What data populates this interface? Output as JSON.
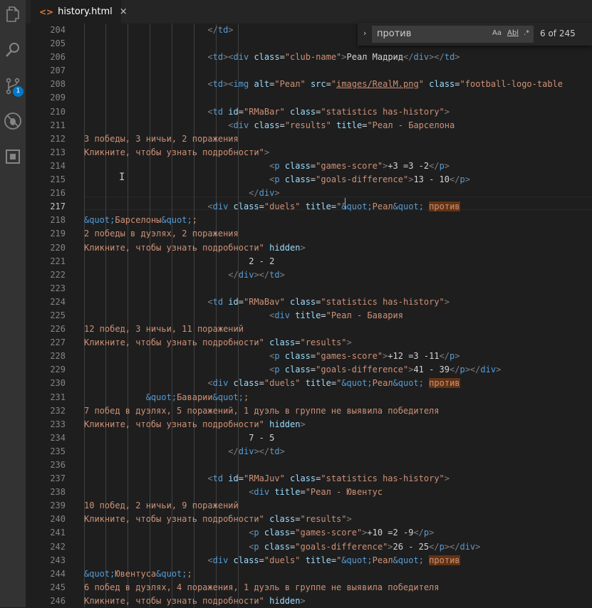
{
  "tab": {
    "icon": "<>",
    "filename": "history.html",
    "close": "×"
  },
  "activity": {
    "scm_badge": "1"
  },
  "find": {
    "query": "против",
    "case_label": "Aa",
    "word_label": "Abl",
    "regex_label": ".*",
    "count": "6 of 245"
  },
  "current_line": "217",
  "lines": [
    {
      "n": "204",
      "t": [
        [
          "tx",
          "                        "
        ],
        [
          "tg",
          "</"
        ],
        [
          "tn",
          "td"
        ],
        [
          "tg",
          ">"
        ]
      ]
    },
    {
      "n": "205",
      "t": []
    },
    {
      "n": "206",
      "t": [
        [
          "tx",
          "                        "
        ],
        [
          "tg",
          "<"
        ],
        [
          "tn",
          "td"
        ],
        [
          "tg",
          "><"
        ],
        [
          "tn",
          "div"
        ],
        [
          "an",
          " class"
        ],
        [
          "tx",
          "="
        ],
        [
          "av",
          "\"club-name\""
        ],
        [
          "tg",
          ">"
        ],
        [
          "tx",
          "Реал Мадрид"
        ],
        [
          "tg",
          "</"
        ],
        [
          "tn",
          "div"
        ],
        [
          "tg",
          "></"
        ],
        [
          "tn",
          "td"
        ],
        [
          "tg",
          ">"
        ]
      ]
    },
    {
      "n": "207",
      "t": []
    },
    {
      "n": "208",
      "t": [
        [
          "tx",
          "                        "
        ],
        [
          "tg",
          "<"
        ],
        [
          "tn",
          "td"
        ],
        [
          "tg",
          "><"
        ],
        [
          "tn",
          "img"
        ],
        [
          "an",
          " alt"
        ],
        [
          "tx",
          "="
        ],
        [
          "av",
          "\"Реал\""
        ],
        [
          "an",
          " src"
        ],
        [
          "tx",
          "="
        ],
        [
          "av",
          "\""
        ],
        [
          "avu",
          "images/RealM.png"
        ],
        [
          "av",
          "\""
        ],
        [
          "an",
          " class"
        ],
        [
          "tx",
          "="
        ],
        [
          "av",
          "\"football-logo-table"
        ]
      ]
    },
    {
      "n": "209",
      "t": []
    },
    {
      "n": "210",
      "t": [
        [
          "tx",
          "                        "
        ],
        [
          "tg",
          "<"
        ],
        [
          "tn",
          "td"
        ],
        [
          "an",
          " id"
        ],
        [
          "tx",
          "="
        ],
        [
          "av",
          "\"RMaBar\""
        ],
        [
          "an",
          " class"
        ],
        [
          "tx",
          "="
        ],
        [
          "av",
          "\"statistics has-history\""
        ],
        [
          "tg",
          ">"
        ]
      ]
    },
    {
      "n": "211",
      "t": [
        [
          "tx",
          "                            "
        ],
        [
          "tg",
          "<"
        ],
        [
          "tn",
          "div"
        ],
        [
          "an",
          " class"
        ],
        [
          "tx",
          "="
        ],
        [
          "av",
          "\"results\""
        ],
        [
          "an",
          " title"
        ],
        [
          "tx",
          "="
        ],
        [
          "av",
          "\"Реал - Барселона"
        ]
      ]
    },
    {
      "n": "212",
      "t": [
        [
          "av",
          "3 победы, 3 ничьи, 2 поражения"
        ]
      ]
    },
    {
      "n": "213",
      "t": [
        [
          "av",
          "Кликните, чтобы узнать подробности\""
        ],
        [
          "tg",
          ">"
        ]
      ]
    },
    {
      "n": "214",
      "t": [
        [
          "tx",
          "                                    "
        ],
        [
          "tg",
          "<"
        ],
        [
          "tn",
          "p"
        ],
        [
          "an",
          " class"
        ],
        [
          "tx",
          "="
        ],
        [
          "av",
          "\"games-score\""
        ],
        [
          "tg",
          ">"
        ],
        [
          "tx",
          "+3 =3 -2"
        ],
        [
          "tg",
          "</"
        ],
        [
          "tn",
          "p"
        ],
        [
          "tg",
          ">"
        ]
      ]
    },
    {
      "n": "215",
      "t": [
        [
          "tx",
          "                                    "
        ],
        [
          "tg",
          "<"
        ],
        [
          "tn",
          "p"
        ],
        [
          "an",
          " class"
        ],
        [
          "tx",
          "="
        ],
        [
          "av",
          "\"goals-difference\""
        ],
        [
          "tg",
          ">"
        ],
        [
          "tx",
          "13 - 10"
        ],
        [
          "tg",
          "</"
        ],
        [
          "tn",
          "p"
        ],
        [
          "tg",
          ">"
        ]
      ]
    },
    {
      "n": "216",
      "t": [
        [
          "tx",
          "                                "
        ],
        [
          "tg",
          "</"
        ],
        [
          "tn",
          "div"
        ],
        [
          "tg",
          ">"
        ]
      ]
    },
    {
      "n": "217",
      "t": [
        [
          "tx",
          "                        "
        ],
        [
          "tg",
          "<"
        ],
        [
          "tn",
          "div"
        ],
        [
          "an",
          " class"
        ],
        [
          "tx",
          "="
        ],
        [
          "av",
          "\"duels\""
        ],
        [
          "an",
          " title"
        ],
        [
          "tx",
          "="
        ],
        [
          "av",
          "\""
        ],
        [
          "en",
          "&quot;"
        ],
        [
          "av",
          "Реал"
        ],
        [
          "en",
          "&quot;"
        ],
        [
          "av",
          " "
        ],
        [
          "hl",
          "против"
        ]
      ]
    },
    {
      "n": "218",
      "t": [
        [
          "en",
          "&quot;"
        ],
        [
          "av",
          "Барселоны"
        ],
        [
          "en",
          "&quot;"
        ],
        [
          "av",
          ";"
        ]
      ]
    },
    {
      "n": "219",
      "t": [
        [
          "av",
          "2 победы в дуэлях, 2 поражения"
        ]
      ]
    },
    {
      "n": "220",
      "t": [
        [
          "av",
          "Кликните, чтобы узнать подробности\""
        ],
        [
          "an",
          " hidden"
        ],
        [
          "tg",
          ">"
        ]
      ]
    },
    {
      "n": "221",
      "t": [
        [
          "tx",
          "                                2 - 2"
        ]
      ]
    },
    {
      "n": "222",
      "t": [
        [
          "tx",
          "                            "
        ],
        [
          "tg",
          "</"
        ],
        [
          "tn",
          "div"
        ],
        [
          "tg",
          "></"
        ],
        [
          "tn",
          "td"
        ],
        [
          "tg",
          ">"
        ]
      ]
    },
    {
      "n": "223",
      "t": []
    },
    {
      "n": "224",
      "t": [
        [
          "tx",
          "                        "
        ],
        [
          "tg",
          "<"
        ],
        [
          "tn",
          "td"
        ],
        [
          "an",
          " id"
        ],
        [
          "tx",
          "="
        ],
        [
          "av",
          "\"RMaBav\""
        ],
        [
          "an",
          " class"
        ],
        [
          "tx",
          "="
        ],
        [
          "av",
          "\"statistics has-history\""
        ],
        [
          "tg",
          ">"
        ]
      ]
    },
    {
      "n": "225",
      "t": [
        [
          "tx",
          "                                    "
        ],
        [
          "tg",
          "<"
        ],
        [
          "tn",
          "div"
        ],
        [
          "an",
          " title"
        ],
        [
          "tx",
          "="
        ],
        [
          "av",
          "\"Реал - Бавария"
        ]
      ]
    },
    {
      "n": "226",
      "t": [
        [
          "av",
          "12 побед, 3 ничьи, 11 поражений"
        ]
      ]
    },
    {
      "n": "227",
      "t": [
        [
          "av",
          "Кликните, чтобы узнать подробности\""
        ],
        [
          "an",
          " class"
        ],
        [
          "tx",
          "="
        ],
        [
          "av",
          "\"results\""
        ],
        [
          "tg",
          ">"
        ]
      ]
    },
    {
      "n": "228",
      "t": [
        [
          "tx",
          "                                    "
        ],
        [
          "tg",
          "<"
        ],
        [
          "tn",
          "p"
        ],
        [
          "an",
          " class"
        ],
        [
          "tx",
          "="
        ],
        [
          "av",
          "\"games-score\""
        ],
        [
          "tg",
          ">"
        ],
        [
          "tx",
          "+12 =3 -11"
        ],
        [
          "tg",
          "</"
        ],
        [
          "tn",
          "p"
        ],
        [
          "tg",
          ">"
        ]
      ]
    },
    {
      "n": "229",
      "t": [
        [
          "tx",
          "                                    "
        ],
        [
          "tg",
          "<"
        ],
        [
          "tn",
          "p"
        ],
        [
          "an",
          " class"
        ],
        [
          "tx",
          "="
        ],
        [
          "av",
          "\"goals-difference\""
        ],
        [
          "tg",
          ">"
        ],
        [
          "tx",
          "41 - 39"
        ],
        [
          "tg",
          "</"
        ],
        [
          "tn",
          "p"
        ],
        [
          "tg",
          "></"
        ],
        [
          "tn",
          "div"
        ],
        [
          "tg",
          ">"
        ]
      ]
    },
    {
      "n": "230",
      "t": [
        [
          "tx",
          "                        "
        ],
        [
          "tg",
          "<"
        ],
        [
          "tn",
          "div"
        ],
        [
          "an",
          " class"
        ],
        [
          "tx",
          "="
        ],
        [
          "av",
          "\"duels\""
        ],
        [
          "an",
          " title"
        ],
        [
          "tx",
          "="
        ],
        [
          "av",
          "\""
        ],
        [
          "en",
          "&quot;"
        ],
        [
          "av",
          "Реал"
        ],
        [
          "en",
          "&quot;"
        ],
        [
          "av",
          " "
        ],
        [
          "hl",
          "против"
        ]
      ]
    },
    {
      "n": "231",
      "t": [
        [
          "tx",
          "            "
        ],
        [
          "en",
          "&quot;"
        ],
        [
          "av",
          "Баварии"
        ],
        [
          "en",
          "&quot;"
        ],
        [
          "av",
          ";"
        ]
      ]
    },
    {
      "n": "232",
      "t": [
        [
          "av",
          "7 побед в дуэлях, 5 поражений, 1 дуэль в группе не выявила победителя"
        ]
      ]
    },
    {
      "n": "233",
      "t": [
        [
          "av",
          "Кликните, чтобы узнать подробности\""
        ],
        [
          "an",
          " hidden"
        ],
        [
          "tg",
          ">"
        ]
      ]
    },
    {
      "n": "234",
      "t": [
        [
          "tx",
          "                                7 - 5"
        ]
      ]
    },
    {
      "n": "235",
      "t": [
        [
          "tx",
          "                            "
        ],
        [
          "tg",
          "</"
        ],
        [
          "tn",
          "div"
        ],
        [
          "tg",
          "></"
        ],
        [
          "tn",
          "td"
        ],
        [
          "tg",
          ">"
        ]
      ]
    },
    {
      "n": "236",
      "t": []
    },
    {
      "n": "237",
      "t": [
        [
          "tx",
          "                        "
        ],
        [
          "tg",
          "<"
        ],
        [
          "tn",
          "td"
        ],
        [
          "an",
          " id"
        ],
        [
          "tx",
          "="
        ],
        [
          "av",
          "\"RMaJuv\""
        ],
        [
          "an",
          " class"
        ],
        [
          "tx",
          "="
        ],
        [
          "av",
          "\"statistics has-history\""
        ],
        [
          "tg",
          ">"
        ]
      ]
    },
    {
      "n": "238",
      "t": [
        [
          "tx",
          "                                "
        ],
        [
          "tg",
          "<"
        ],
        [
          "tn",
          "div"
        ],
        [
          "an",
          " title"
        ],
        [
          "tx",
          "="
        ],
        [
          "av",
          "\"Реал - Ювентус"
        ]
      ]
    },
    {
      "n": "239",
      "t": [
        [
          "av",
          "10 побед, 2 ничьи, 9 поражений"
        ]
      ]
    },
    {
      "n": "240",
      "t": [
        [
          "av",
          "Кликните, чтобы узнать подробности\""
        ],
        [
          "an",
          " class"
        ],
        [
          "tx",
          "="
        ],
        [
          "av",
          "\"results\""
        ],
        [
          "tg",
          ">"
        ]
      ]
    },
    {
      "n": "241",
      "t": [
        [
          "tx",
          "                                "
        ],
        [
          "tg",
          "<"
        ],
        [
          "tn",
          "p"
        ],
        [
          "an",
          " class"
        ],
        [
          "tx",
          "="
        ],
        [
          "av",
          "\"games-score\""
        ],
        [
          "tg",
          ">"
        ],
        [
          "tx",
          "+10 =2 -9"
        ],
        [
          "tg",
          "</"
        ],
        [
          "tn",
          "p"
        ],
        [
          "tg",
          ">"
        ]
      ]
    },
    {
      "n": "242",
      "t": [
        [
          "tx",
          "                                "
        ],
        [
          "tg",
          "<"
        ],
        [
          "tn",
          "p"
        ],
        [
          "an",
          " class"
        ],
        [
          "tx",
          "="
        ],
        [
          "av",
          "\"goals-difference\""
        ],
        [
          "tg",
          ">"
        ],
        [
          "tx",
          "26 - 25"
        ],
        [
          "tg",
          "</"
        ],
        [
          "tn",
          "p"
        ],
        [
          "tg",
          "></"
        ],
        [
          "tn",
          "div"
        ],
        [
          "tg",
          ">"
        ]
      ]
    },
    {
      "n": "243",
      "t": [
        [
          "tx",
          "                        "
        ],
        [
          "tg",
          "<"
        ],
        [
          "tn",
          "div"
        ],
        [
          "an",
          " class"
        ],
        [
          "tx",
          "="
        ],
        [
          "av",
          "\"duels\""
        ],
        [
          "an",
          " title"
        ],
        [
          "tx",
          "="
        ],
        [
          "av",
          "\""
        ],
        [
          "en",
          "&quot;"
        ],
        [
          "av",
          "Реал"
        ],
        [
          "en",
          "&quot;"
        ],
        [
          "av",
          " "
        ],
        [
          "hl",
          "против"
        ]
      ]
    },
    {
      "n": "244",
      "t": [
        [
          "en",
          "&quot;"
        ],
        [
          "av",
          "Ювентуса"
        ],
        [
          "en",
          "&quot;"
        ],
        [
          "av",
          ";"
        ]
      ]
    },
    {
      "n": "245",
      "t": [
        [
          "av",
          "6 побед в дуэлях, 4 поражения, 1 дуэль в группе не выявила победителя"
        ]
      ]
    },
    {
      "n": "246",
      "t": [
        [
          "av",
          "Кликните, чтобы узнать подробности\""
        ],
        [
          "an",
          " hidden"
        ],
        [
          "tg",
          ">"
        ]
      ]
    }
  ]
}
